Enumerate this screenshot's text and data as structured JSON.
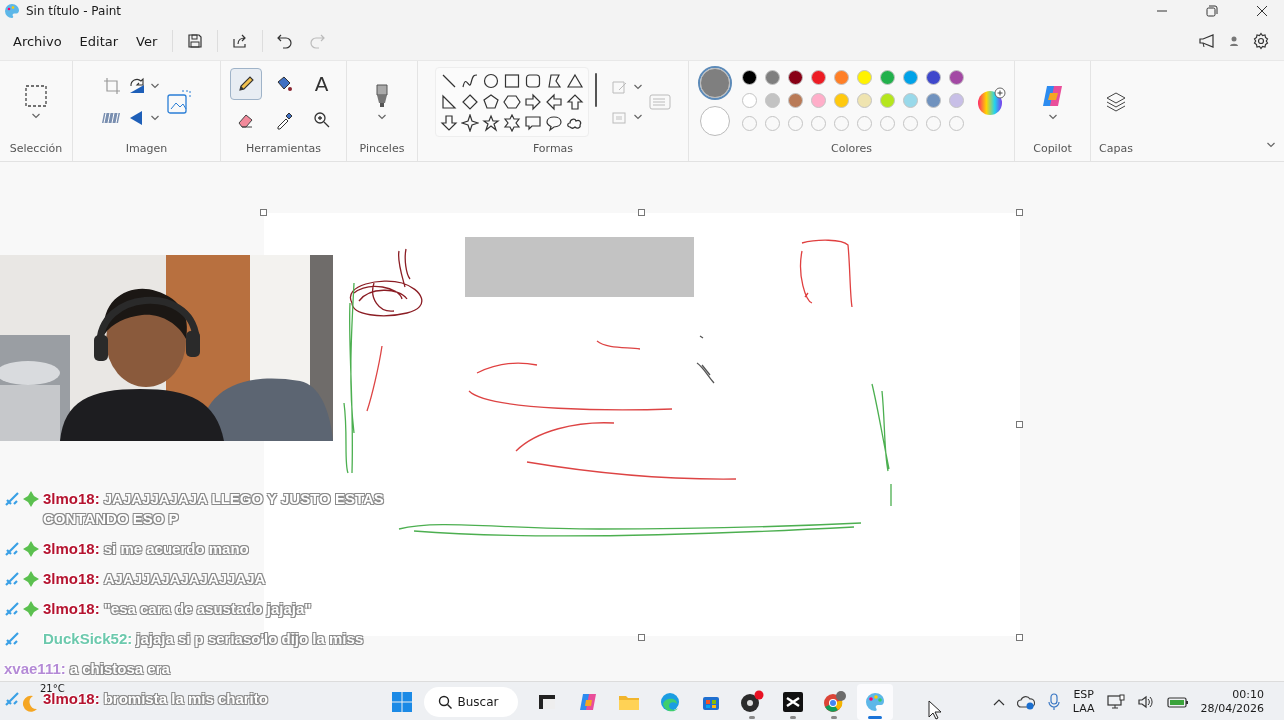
{
  "window": {
    "title": "Sin título - Paint"
  },
  "menu": [
    {
      "label": "Archivo"
    },
    {
      "label": "Editar"
    },
    {
      "label": "Ver"
    }
  ],
  "ribbon": {
    "selection_label": "Selección",
    "image_label": "Imagen",
    "tools": {
      "label": "Herramientas",
      "items": [
        {
          "kind": "pencil",
          "selected": true
        },
        {
          "kind": "fill",
          "selected": false
        },
        {
          "kind": "text",
          "glyph": "A",
          "selected": false
        },
        {
          "kind": "eraser",
          "selected": false
        },
        {
          "kind": "picker",
          "selected": false
        },
        {
          "kind": "magnifier",
          "selected": false
        }
      ]
    },
    "brushes_label": "Pinceles",
    "shapes_label": "Formas",
    "colors": {
      "label": "Colores",
      "primary": {
        "color": "#7f7f7f",
        "selected": true
      },
      "secondary": {
        "color": "#ffffff",
        "selected": false
      },
      "palette": [
        {
          "kind": "swatch",
          "color": "#000000"
        },
        {
          "kind": "swatch",
          "color": "#7f7f7f"
        },
        {
          "kind": "swatch",
          "color": "#880015"
        },
        {
          "kind": "swatch",
          "color": "#ed1c24"
        },
        {
          "kind": "swatch",
          "color": "#ff7f27"
        },
        {
          "kind": "swatch",
          "color": "#fff200"
        },
        {
          "kind": "swatch",
          "color": "#22b14c"
        },
        {
          "kind": "swatch",
          "color": "#00a2e8"
        },
        {
          "kind": "swatch",
          "color": "#3f48cc"
        },
        {
          "kind": "swatch",
          "color": "#a349a4"
        },
        {
          "kind": "swatch",
          "color": "#ffffff"
        },
        {
          "kind": "swatch",
          "color": "#c3c3c3"
        },
        {
          "kind": "swatch",
          "color": "#b97a57"
        },
        {
          "kind": "swatch",
          "color": "#ffaec9"
        },
        {
          "kind": "swatch",
          "color": "#ffc90e"
        },
        {
          "kind": "swatch",
          "color": "#efe4b0"
        },
        {
          "kind": "swatch",
          "color": "#b5e61d"
        },
        {
          "kind": "swatch",
          "color": "#99d9ea"
        },
        {
          "kind": "swatch",
          "color": "#7092be"
        },
        {
          "kind": "swatch",
          "color": "#c8bfe7"
        },
        {
          "kind": "empty"
        },
        {
          "kind": "empty"
        },
        {
          "kind": "empty"
        },
        {
          "kind": "empty"
        },
        {
          "kind": "empty"
        },
        {
          "kind": "empty"
        },
        {
          "kind": "empty"
        },
        {
          "kind": "empty"
        },
        {
          "kind": "empty"
        },
        {
          "kind": "empty"
        }
      ]
    },
    "copilot_label": "Copilot",
    "layers_label": "Capas"
  },
  "chat": {
    "messages": [
      {
        "user": "3lmo18:",
        "color": "#b5132f",
        "text": "JAJAJJAJAJA LLEGO Y JUSTO ESTAS CONTANDO ESO P",
        "moderator": true,
        "subscriber": true
      },
      {
        "user": "3lmo18:",
        "color": "#b5132f",
        "text": "si me acuerdo mano",
        "moderator": true,
        "subscriber": true
      },
      {
        "user": "3lmo18:",
        "color": "#b5132f",
        "text": "AJAJJAJAJAJAJJAJA",
        "moderator": true,
        "subscriber": true
      },
      {
        "user": "3lmo18:",
        "color": "#b5132f",
        "text": "\"esa cara de asustado jajaja\"",
        "moderator": true,
        "subscriber": true
      },
      {
        "user": "DuckSick52:",
        "color": "#6cc9ad",
        "text": "jajaja si p seriaso'lo dijo la miss",
        "moderator": true,
        "subscriber": false
      },
      {
        "user": "xvae111:",
        "color": "#b48ad6",
        "text": "a chistosa era",
        "moderator": false,
        "subscriber": false
      },
      {
        "user": "3lmo18:",
        "color": "#b5132f",
        "text": "bromista la mis charito",
        "moderator": true,
        "subscriber": false
      }
    ]
  },
  "taskbar": {
    "weather": {
      "temperature": "21°C"
    },
    "search": {
      "label": "Buscar"
    },
    "apps": [
      {
        "kind": "terminal",
        "running": false,
        "selected": false
      },
      {
        "kind": "copilot",
        "running": false,
        "selected": false
      },
      {
        "kind": "explorer",
        "running": false,
        "selected": false
      },
      {
        "kind": "edge",
        "running": false,
        "selected": false
      },
      {
        "kind": "store",
        "running": false,
        "selected": false
      },
      {
        "kind": "obs",
        "running": true,
        "selected": false
      },
      {
        "kind": "capcut",
        "running": true,
        "selected": false
      },
      {
        "kind": "chrome",
        "running": true,
        "selected": false
      },
      {
        "kind": "paint",
        "running": true,
        "selected": true
      }
    ],
    "language": {
      "line1": "ESP",
      "line2": "LAA"
    },
    "clock": {
      "time": "00:10",
      "date": "28/04/2026"
    }
  }
}
